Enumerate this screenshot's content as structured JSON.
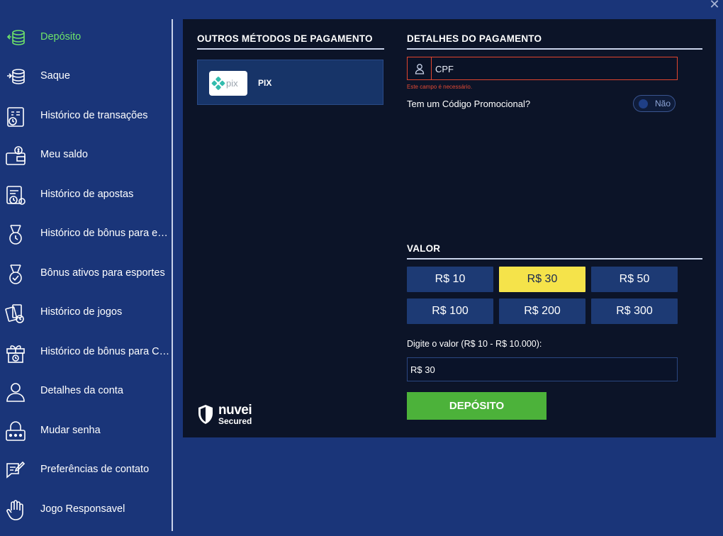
{
  "window": {
    "close_icon": "close-icon"
  },
  "sidebar": {
    "items": [
      {
        "label": "Depósito",
        "icon": "database-coins-icon",
        "active": true
      },
      {
        "label": "Saque",
        "icon": "database-coins-icon"
      },
      {
        "label": "Histórico de transações",
        "icon": "receipt-history-icon"
      },
      {
        "label": "Meu saldo",
        "icon": "wallet-icon"
      },
      {
        "label": "Histórico de apostas",
        "icon": "betslip-history-icon"
      },
      {
        "label": "Histórico de bônus para esp...",
        "icon": "medal-history-icon"
      },
      {
        "label": "Bônus ativos para esportes",
        "icon": "medal-check-icon"
      },
      {
        "label": "Histórico de jogos",
        "icon": "cards-history-icon"
      },
      {
        "label": "Histórico de bônus para Ca...",
        "icon": "gift-history-icon"
      },
      {
        "label": "Detalhes da conta",
        "icon": "user-icon"
      },
      {
        "label": "Mudar senha",
        "icon": "lock-icon"
      },
      {
        "label": "Preferências de contato",
        "icon": "chat-edit-icon"
      },
      {
        "label": "Jogo Responsavel",
        "icon": "hand-icon"
      }
    ]
  },
  "payment_methods": {
    "title": "OUTROS MÉTODOS DE PAGAMENTO",
    "items": [
      {
        "label": "PIX",
        "logo_text": "pix"
      }
    ]
  },
  "details": {
    "title": "DETALHES DO PAGAMENTO",
    "cpf_placeholder": "CPF",
    "cpf_error": "Este campo é necessário.",
    "promo_label": "Tem um Código Promocional?",
    "promo_toggle": "Não"
  },
  "amount": {
    "title": "VALOR",
    "options": [
      "R$ 10",
      "R$ 30",
      "R$ 50",
      "R$ 100",
      "R$ 200",
      "R$ 300"
    ],
    "selected": "R$ 30",
    "input_label": "Digite o valor (R$ 10 - R$ 10.000):",
    "input_value": "R$ 30",
    "submit": "DEPÓSITO"
  },
  "security": {
    "brand": "nuvei",
    "tagline": "Secured"
  },
  "colors": {
    "background": "#1a3579",
    "panel": "#0c1428",
    "active": "#6ee36a",
    "selected_amount": "#f5e34a",
    "deposit_button": "#4cb23a",
    "error": "#e24a35"
  }
}
